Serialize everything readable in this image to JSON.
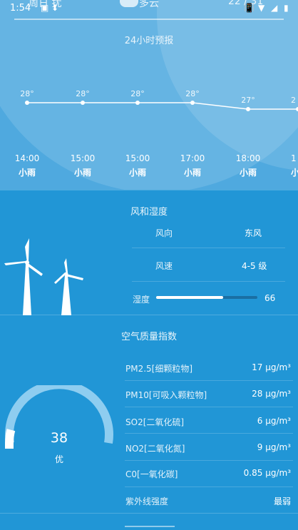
{
  "status_bar": {
    "time": "1:54",
    "ghost_left": "周日 扰",
    "ghost_center": "多云",
    "ghost_right": "22 / 31"
  },
  "forecast": {
    "title": "24小时预报",
    "hours": [
      {
        "time": "14:00",
        "weather": "小雨",
        "temp": "28°"
      },
      {
        "time": "15:00",
        "weather": "小雨",
        "temp": "28°"
      },
      {
        "time": "15:00",
        "weather": "小雨",
        "temp": "28°"
      },
      {
        "time": "17:00",
        "weather": "小雨",
        "temp": "28°"
      },
      {
        "time": "18:00",
        "weather": "小雨",
        "temp": "27°"
      },
      {
        "time": "1",
        "weather": "小",
        "temp": "2"
      }
    ]
  },
  "wind": {
    "title": "风和湿度",
    "direction_label": "风向",
    "direction_value": "东风",
    "speed_label": "风速",
    "speed_value": "4-5 级",
    "humidity_label": "湿度",
    "humidity_value": "66",
    "humidity_fraction": 0.66
  },
  "air_quality": {
    "title": "空气质量指数",
    "aqi_value": "38",
    "aqi_level": "优",
    "aqi_fraction": 0.08,
    "rows": [
      {
        "label": "PM2.5[细颗粒物]",
        "value": "17 μg/m³"
      },
      {
        "label": "PM10[可吸入颗粒物]",
        "value": "28 μg/m³"
      },
      {
        "label": "SO2[二氧化硫]",
        "value": "6 μg/m³"
      },
      {
        "label": "NO2[二氧化氮]",
        "value": "9 μg/m³"
      },
      {
        "label": "C0[一氧化碳]",
        "value": "0.85 μg/m³"
      },
      {
        "label": "紫外线强度",
        "value": "最弱"
      }
    ]
  },
  "colors": {
    "top_background": "#4fa9df",
    "main_background": "#2196d6",
    "accent_light": "#8ecdf0"
  }
}
